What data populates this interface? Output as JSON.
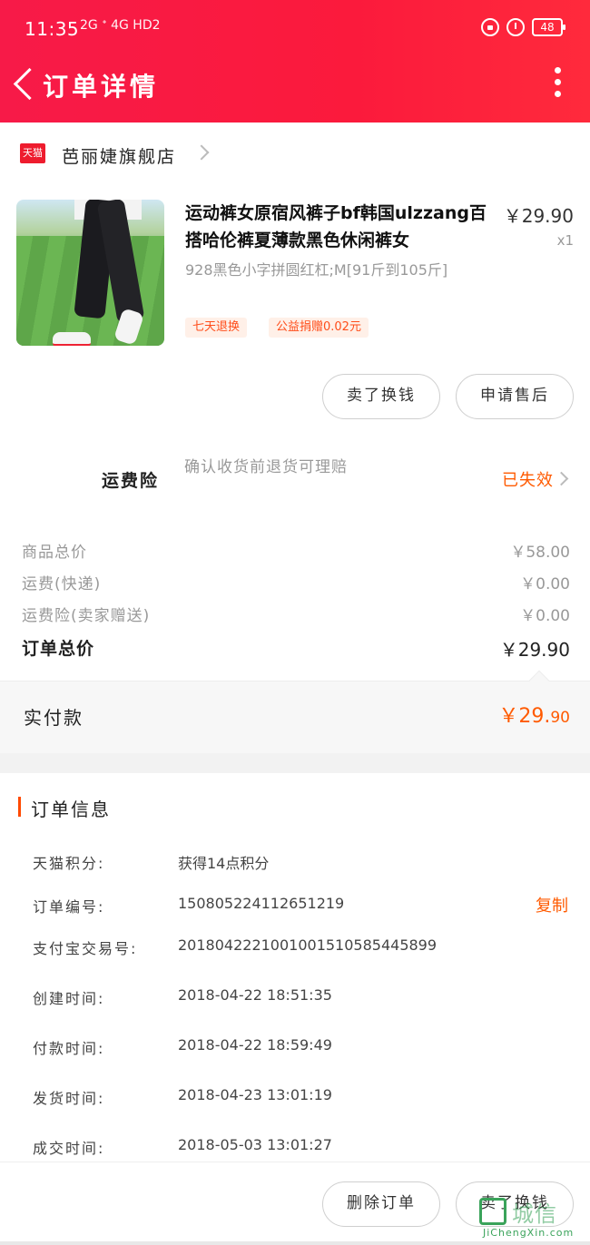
{
  "status_bar": {
    "time": "11:35",
    "signal": "2G ᐩ 4G HD2",
    "battery": "48"
  },
  "nav": {
    "title": "订单详情"
  },
  "shop": {
    "badge": "天猫",
    "name": "芭丽婕旗舰店"
  },
  "product": {
    "title": "运动裤女原宿风裤子bf韩国ulzzang百搭哈伦裤夏薄款黑色休闲裤女",
    "price": "￥29.90",
    "qty": "x1",
    "sku": "928黑色小字拼圆红杠;M[91斤到105斤]",
    "tags": [
      "七天退换",
      "公益捐赠0.02元"
    ]
  },
  "actions": {
    "sell": "卖了换钱",
    "after_sale": "申请售后",
    "delete": "删除订单"
  },
  "insurance": {
    "label": "运费险",
    "desc": "确认收货前退货可理赔",
    "status": "已失效"
  },
  "summary": {
    "goods_label": "商品总价",
    "goods_val": "￥58.00",
    "ship_label": "运费(快递)",
    "ship_val": "￥0.00",
    "ins_label": "运费险(卖家赠送)",
    "ins_val": "￥0.00",
    "total_label": "订单总价",
    "total_val": "￥29.90"
  },
  "paid": {
    "label": "实付款",
    "main": "￥29.",
    "cents": "90"
  },
  "order_info": {
    "title": "订单信息",
    "copy": "复制",
    "rows": [
      {
        "label": "天猫积分:",
        "value": "获得14点积分"
      },
      {
        "label": "订单编号:",
        "value": "150805224112651219"
      },
      {
        "label": "支付宝交易号:",
        "value": "2018042221001001510585445899"
      },
      {
        "label": "创建时间:",
        "value": "2018-04-22 18:51:35"
      },
      {
        "label": "付款时间:",
        "value": "2018-04-22 18:59:49"
      },
      {
        "label": "发货时间:",
        "value": "2018-04-23 13:01:19"
      },
      {
        "label": "成交时间:",
        "value": "2018-05-03 13:01:27"
      }
    ]
  },
  "watermark": {
    "text": "城信",
    "url": "JiChengXin.com"
  },
  "colors": {
    "header": "#f71a48",
    "accent": "#ff5a00"
  }
}
